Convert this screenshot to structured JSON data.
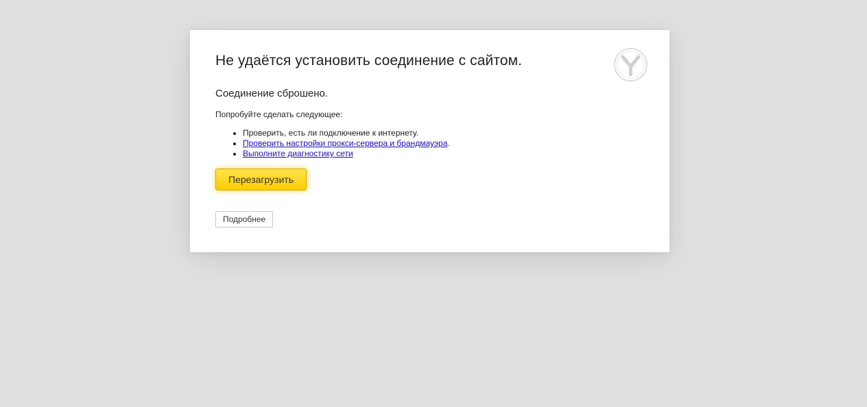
{
  "error_page": {
    "title": "Не удаётся установить соединение с сайтом.",
    "subtitle": "Соединение сброшено.",
    "try_label": "Попробуйте сделать следующее:",
    "suggestions": [
      {
        "text": "Проверить, есть ли подключение к интернету.",
        "link": false
      },
      {
        "text": "Проверить настройки прокси-сервера и брандмауэра",
        "link": true,
        "suffix": "."
      },
      {
        "text": "Выполните диагностику сети",
        "link": true,
        "suffix": ""
      }
    ],
    "reload_label": "Перезагрузить",
    "details_label": "Подробнее",
    "logo_icon": "yandex-browser-logo-icon"
  },
  "colors": {
    "background": "#e0e0e0",
    "card": "#ffffff",
    "accent_button": "#ffcc00",
    "link": "#1a0dab"
  }
}
